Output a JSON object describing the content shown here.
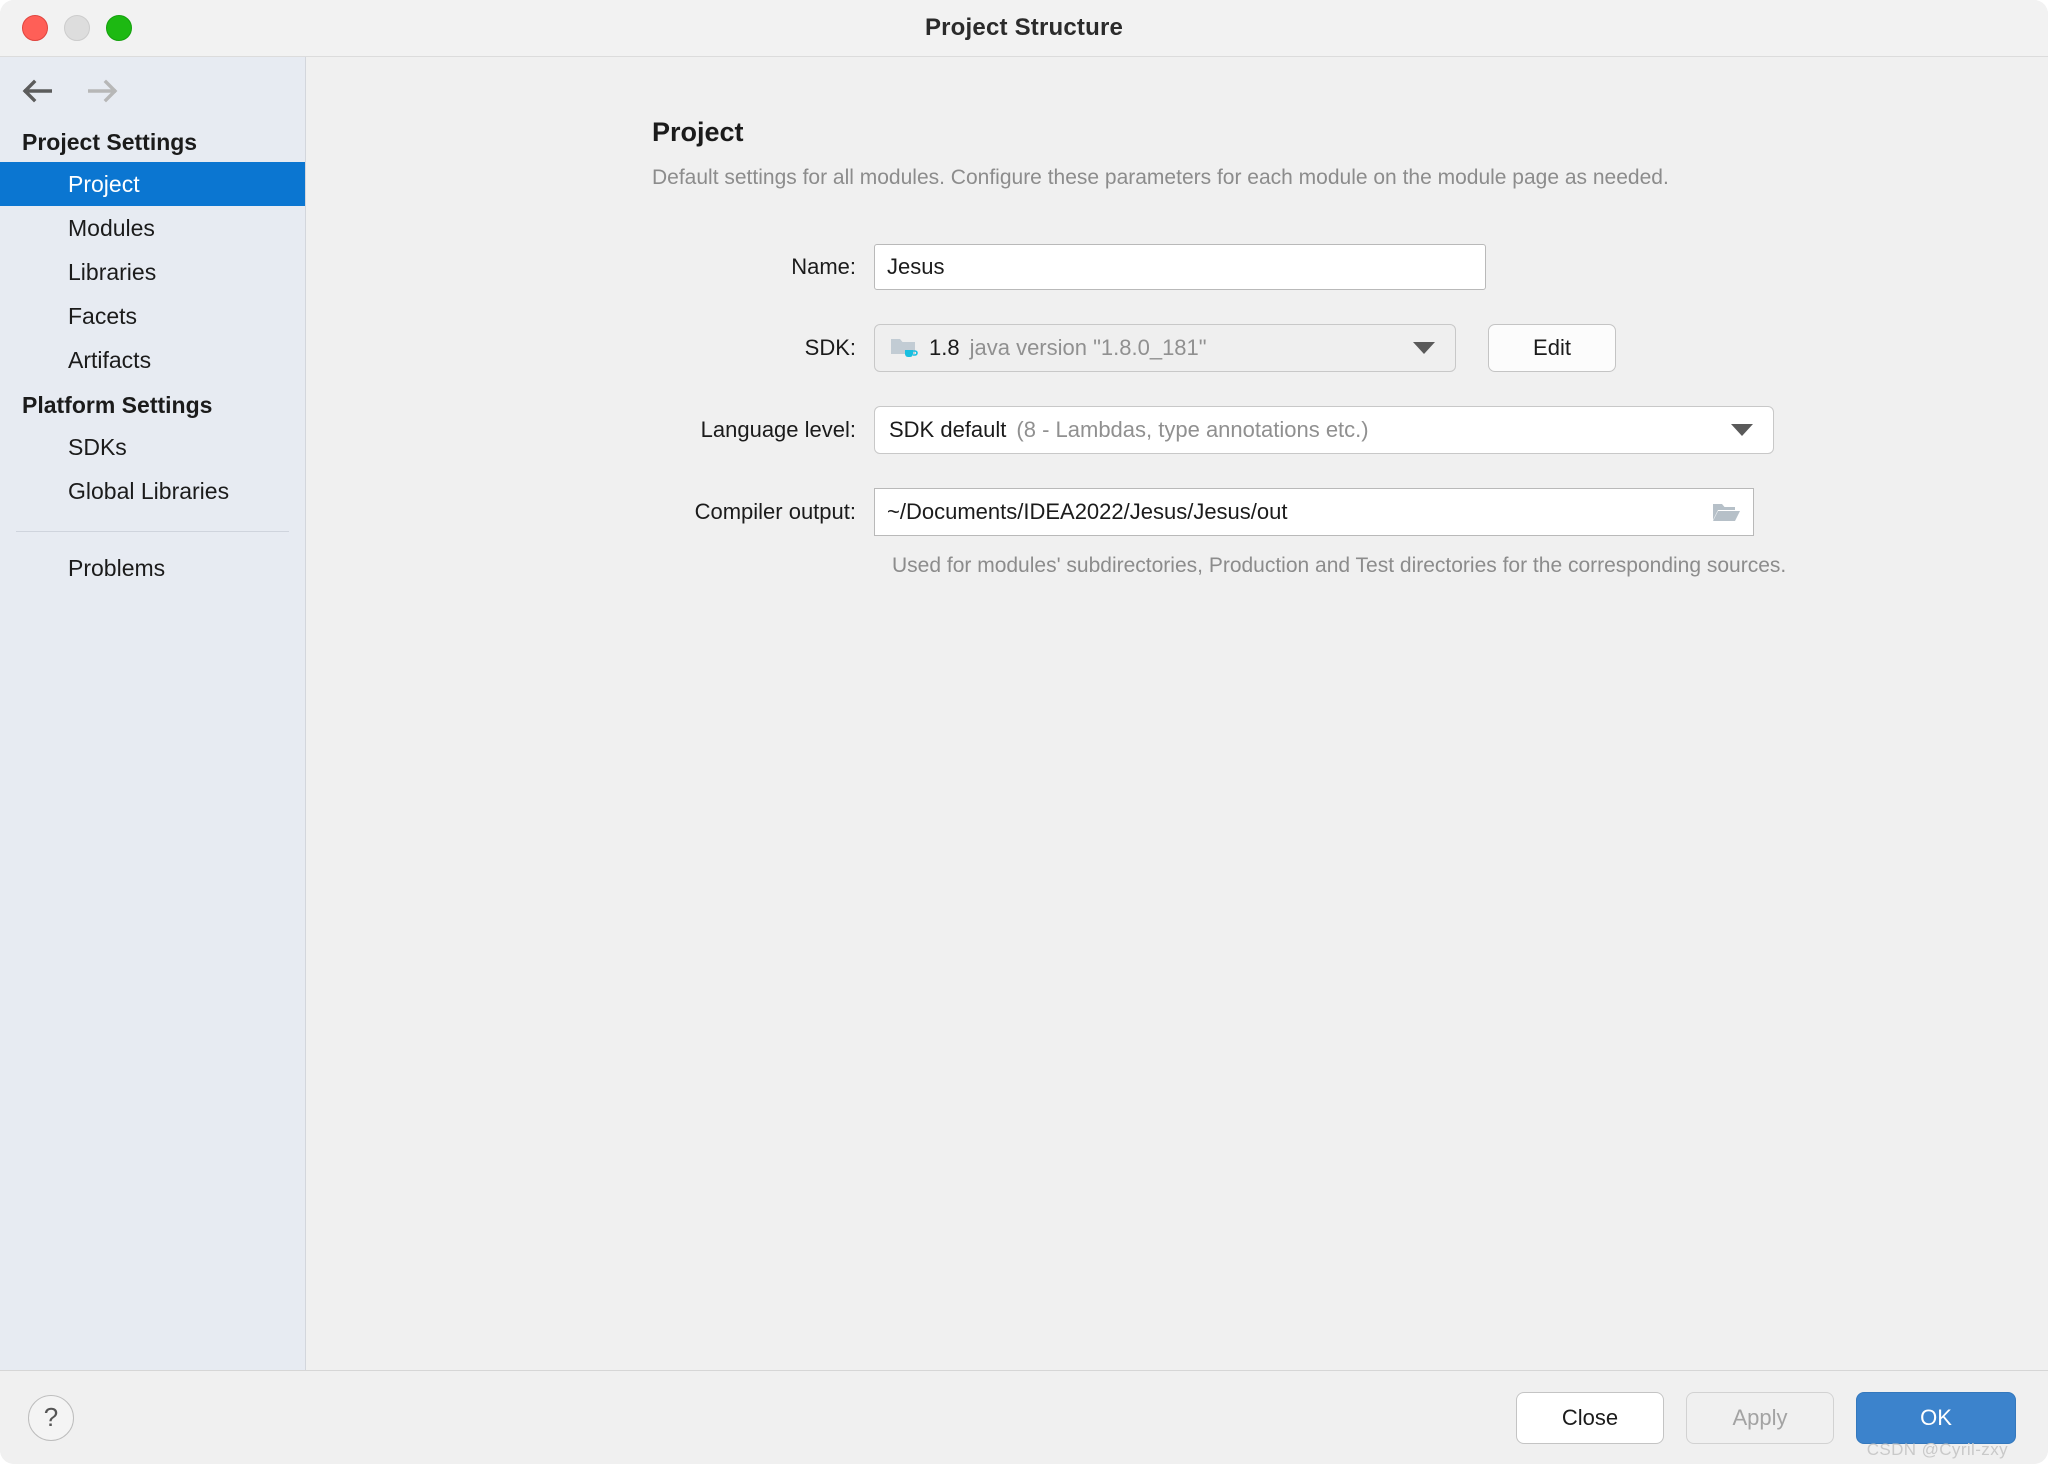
{
  "window": {
    "title": "Project Structure",
    "traffic_lights": [
      "close",
      "minimize",
      "zoom"
    ]
  },
  "nav": {
    "back_label": "back-arrow",
    "forward_label": "forward-arrow"
  },
  "sidebar": {
    "groups": [
      {
        "title": "Project Settings",
        "items": [
          {
            "label": "Project",
            "selected": true
          },
          {
            "label": "Modules",
            "selected": false
          },
          {
            "label": "Libraries",
            "selected": false
          },
          {
            "label": "Facets",
            "selected": false
          },
          {
            "label": "Artifacts",
            "selected": false
          }
        ]
      },
      {
        "title": "Platform Settings",
        "items": [
          {
            "label": "SDKs",
            "selected": false
          },
          {
            "label": "Global Libraries",
            "selected": false
          }
        ]
      }
    ],
    "footer_items": [
      {
        "label": "Problems",
        "selected": false
      }
    ]
  },
  "main": {
    "title": "Project",
    "description": "Default settings for all modules. Configure these parameters for each module on the module page as needed.",
    "fields": {
      "name": {
        "label": "Name:",
        "value": "Jesus"
      },
      "sdk": {
        "label": "SDK:",
        "version": "1.8",
        "detail": "java version \"1.8.0_181\"",
        "icon": "java-sdk-icon",
        "edit_button": "Edit"
      },
      "language_level": {
        "label": "Language level:",
        "value": "SDK default",
        "detail": "(8 - Lambdas, type annotations etc.)"
      },
      "compiler_output": {
        "label": "Compiler output:",
        "value": "~/Documents/IDEA2022/Jesus/Jesus/out",
        "browse_icon": "folder-icon",
        "help": "Used for modules' subdirectories, Production and Test directories for the corresponding sources."
      }
    }
  },
  "footer": {
    "help_label": "?",
    "close_label": "Close",
    "apply_label": "Apply",
    "ok_label": "OK",
    "watermark": "CSDN @Cyril-zxy"
  },
  "colors": {
    "accent": "#0b76d1",
    "ok_button": "#3c83cc",
    "sidebar_bg": "#e7ebf2",
    "content_bg": "#f0f0f0",
    "muted_text": "#8c8c8c"
  }
}
